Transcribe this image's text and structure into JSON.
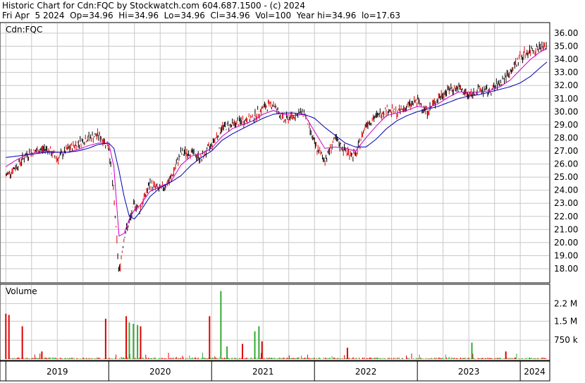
{
  "header": {
    "line1": "Historic Chart for Cdn:FQC by Stockwatch.com 604.687.1500 - (c) 2024",
    "line2": "Fri Apr  5 2024  Op=34.96  Hi=34.96  Lo=34.96  Cl=34.96  Vol=100  Year hi=34.96  lo=17.63"
  },
  "price_panel": {
    "label": "Cdn:FQC"
  },
  "volume_panel": {
    "label": "Volume"
  },
  "colors": {
    "up_bar": "#000000",
    "down_bar": "#dd0000",
    "ma_short": "#cc00cc",
    "ma_long": "#0000aa",
    "grid": "#c8c8c8",
    "volume_up": "#33aa33",
    "volume_down": "#dd0000"
  },
  "chart_data": [
    {
      "type": "line",
      "title": "Cdn:FQC",
      "ylim": [
        17,
        36.5
      ],
      "y_ticks": [
        "36.00",
        "35.00",
        "34.00",
        "33.00",
        "32.00",
        "31.00",
        "30.00",
        "29.00",
        "28.00",
        "27.00",
        "26.00",
        "25.00",
        "24.00",
        "23.00",
        "22.00",
        "21.00",
        "20.00",
        "19.00",
        "18.00"
      ],
      "x": [
        2019.0,
        2019.1,
        2019.2,
        2019.3,
        2019.4,
        2019.5,
        2019.6,
        2019.7,
        2019.8,
        2019.9,
        2020.0,
        2020.05,
        2020.1,
        2020.15,
        2020.2,
        2020.25,
        2020.3,
        2020.4,
        2020.5,
        2020.6,
        2020.7,
        2020.8,
        2020.9,
        2021.0,
        2021.1,
        2021.2,
        2021.3,
        2021.4,
        2021.5,
        2021.6,
        2021.7,
        2021.8,
        2021.9,
        2022.0,
        2022.1,
        2022.2,
        2022.3,
        2022.4,
        2022.5,
        2022.6,
        2022.7,
        2022.8,
        2022.9,
        2023.0,
        2023.1,
        2023.2,
        2023.3,
        2023.4,
        2023.5,
        2023.6,
        2023.7,
        2023.8,
        2023.9,
        2024.0,
        2024.1,
        2024.2,
        2024.26
      ],
      "series": [
        {
          "values": [
            25.1,
            25.8,
            26.7,
            27.0,
            27.2,
            26.4,
            27.1,
            27.6,
            28.0,
            28.2,
            27.4,
            23.5,
            17.6,
            20.5,
            21.5,
            23.0,
            22.5,
            24.5,
            24.0,
            24.8,
            26.8,
            26.9,
            26.4,
            27.5,
            28.8,
            29.0,
            29.3,
            29.5,
            30.3,
            30.6,
            29.3,
            29.7,
            30.0,
            27.5,
            26.3,
            27.9,
            27.0,
            26.6,
            29.1,
            29.6,
            30.2,
            29.9,
            30.4,
            30.8,
            30.0,
            31.0,
            31.7,
            31.8,
            31.2,
            31.7,
            31.5,
            32.2,
            33.0,
            34.2,
            34.7,
            34.96,
            34.96
          ]
        },
        {
          "values": [
            25.8,
            26.3,
            26.7,
            26.9,
            27.0,
            26.9,
            26.9,
            27.1,
            27.4,
            27.6,
            27.6,
            25.8,
            20.5,
            20.7,
            21.8,
            22.5,
            22.8,
            23.9,
            24.3,
            24.6,
            25.9,
            26.6,
            26.8,
            27.2,
            28.1,
            28.7,
            29.0,
            29.3,
            29.8,
            30.1,
            29.8,
            29.7,
            29.8,
            28.5,
            27.2,
            27.3,
            27.2,
            27.0,
            28.0,
            28.9,
            29.7,
            29.9,
            30.1,
            30.4,
            30.3,
            30.6,
            31.1,
            31.5,
            31.5,
            31.5,
            31.6,
            31.9,
            32.4,
            33.2,
            34.0,
            34.6,
            34.8
          ]
        },
        {
          "values": [
            26.5,
            26.6,
            26.7,
            26.8,
            26.9,
            26.9,
            26.9,
            27.0,
            27.2,
            27.5,
            27.6,
            27.2,
            25.5,
            23.5,
            22.0,
            21.8,
            22.3,
            23.5,
            24.2,
            24.6,
            25.1,
            25.9,
            26.5,
            27.0,
            27.8,
            28.3,
            28.7,
            29.1,
            29.5,
            29.8,
            29.9,
            29.9,
            29.8,
            29.5,
            28.8,
            28.2,
            27.6,
            27.3,
            27.3,
            27.9,
            28.7,
            29.3,
            29.7,
            30.0,
            30.2,
            30.4,
            30.7,
            31.0,
            31.2,
            31.3,
            31.5,
            31.7,
            31.9,
            32.2,
            32.7,
            33.4,
            33.8
          ]
        }
      ]
    },
    {
      "type": "bar",
      "title": "Volume",
      "y_ticks": [
        "2.2 M",
        "1.5 M",
        "750 k"
      ],
      "ylim": [
        0,
        2.8
      ],
      "x_labels": [
        "2019",
        "2020",
        "2021",
        "2022",
        "2023",
        "2024"
      ],
      "spikes": [
        {
          "x": 2019.0,
          "value": 1.8,
          "dir": "down"
        },
        {
          "x": 2019.03,
          "value": 1.75,
          "dir": "down"
        },
        {
          "x": 2019.16,
          "value": 1.3,
          "dir": "down"
        },
        {
          "x": 2019.35,
          "value": 0.3,
          "dir": "down"
        },
        {
          "x": 2019.97,
          "value": 1.6,
          "dir": "down"
        },
        {
          "x": 2020.17,
          "value": 1.7,
          "dir": "down"
        },
        {
          "x": 2020.2,
          "value": 1.45,
          "dir": "up"
        },
        {
          "x": 2020.24,
          "value": 1.4,
          "dir": "up"
        },
        {
          "x": 2020.28,
          "value": 1.35,
          "dir": "up"
        },
        {
          "x": 2020.31,
          "value": 1.3,
          "dir": "down"
        },
        {
          "x": 2020.98,
          "value": 1.7,
          "dir": "down"
        },
        {
          "x": 2021.09,
          "value": 2.7,
          "dir": "up"
        },
        {
          "x": 2021.15,
          "value": 0.5,
          "dir": "up"
        },
        {
          "x": 2021.3,
          "value": 0.6,
          "dir": "down"
        },
        {
          "x": 2021.42,
          "value": 1.1,
          "dir": "up"
        },
        {
          "x": 2021.46,
          "value": 1.3,
          "dir": "up"
        },
        {
          "x": 2021.49,
          "value": 0.7,
          "dir": "down"
        },
        {
          "x": 2022.32,
          "value": 0.45,
          "dir": "down"
        },
        {
          "x": 2023.53,
          "value": 0.65,
          "dir": "up"
        },
        {
          "x": 2023.86,
          "value": 0.3,
          "dir": "down"
        }
      ]
    }
  ]
}
